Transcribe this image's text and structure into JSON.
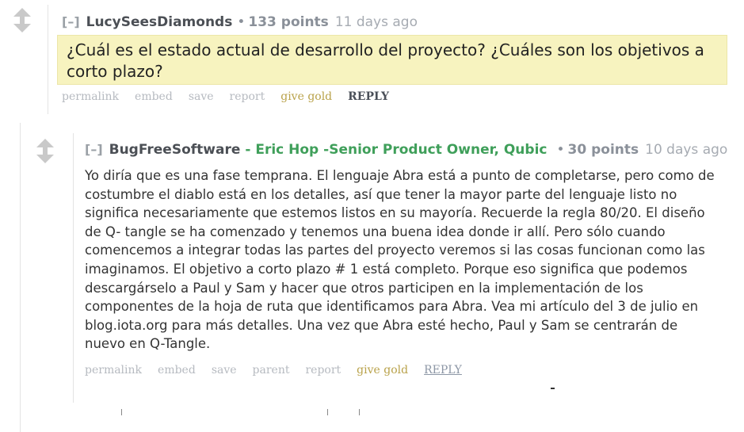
{
  "comment1": {
    "collapse": "[–]",
    "author": "LucySeesDiamonds",
    "bullet": "•",
    "points": "133 points",
    "time": "11 days ago",
    "body": "¿Cuál es el estado actual de desarrollo del proyecto? ¿Cuáles son los objetivos a corto plazo?",
    "actions": {
      "permalink": "permalink",
      "embed": "embed",
      "save": "save",
      "report": "report",
      "give_gold": "give gold",
      "reply": "REPLY"
    }
  },
  "comment2": {
    "collapse": "[–]",
    "author": "BugFreeSoftware",
    "flair": "- Eric Hop -Senior Product Owner, Qubic",
    "bullet": "•",
    "points": "30 points",
    "time": "10 days ago",
    "body": "Yo diría que es una fase temprana. El lenguaje Abra está a punto de completarse, pero como de costumbre el diablo está en los detalles, así que tener la mayor parte del lenguaje listo no significa necesariamente que estemos listos en su mayoría. Recuerde la regla 80/20. El diseño de Q- tangle se ha comenzado y tenemos una buena idea donde ir allí. Pero sólo cuando comencemos a integrar todas las partes del proyecto veremos si las cosas funcionan como las imaginamos. El objetivo a corto plazo # 1 está completo. Porque eso significa que podemos descargárselo a Paul y Sam y hacer que otros participen en la implementación de los componentes de la hoja de ruta que identificamos para Abra. Vea mi artículo del 3 de julio en blog.iota.org para más detalles. Una vez que Abra esté hecho, Paul y Sam se centrarán de nuevo en Q-Tangle.",
    "actions": {
      "permalink": "permalink",
      "embed": "embed",
      "save": "save",
      "parent": "parent",
      "report": "report",
      "give_gold": "give gold",
      "reply": "REPLY"
    }
  },
  "colors": {
    "highlight": "#f7f3bf",
    "flair": "#3f9f5a",
    "gold": "#b9a24a",
    "arrow": "#c9c9c9"
  }
}
